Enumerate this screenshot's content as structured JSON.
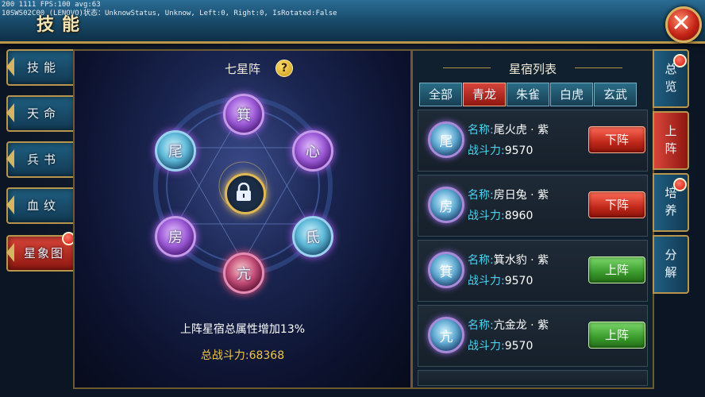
{
  "debug": {
    "line1": "200 1111 FPS:100 avg:63",
    "line2": "10SWS02C00 (LENOVO)状态：UnknowStatus, Unknow, Left:0, Right:0, IsRotated:False"
  },
  "header": {
    "title": "技能",
    "close_icon": "close-icon"
  },
  "left_tabs": [
    {
      "label": "技能"
    },
    {
      "label": "天命"
    },
    {
      "label": "兵书"
    },
    {
      "label": "血纹"
    },
    {
      "label": "星象图"
    }
  ],
  "center": {
    "title": "七星阵",
    "help_icon": "?",
    "bonus_text": "上阵星宿总属性增加13%",
    "total_power": "总战斗力:68368",
    "nodes": [
      {
        "glyph": "箕",
        "color": "purple"
      },
      {
        "glyph": "尾",
        "color": "blue"
      },
      {
        "glyph": "心",
        "color": "purple"
      },
      {
        "glyph": "房",
        "color": "purple"
      },
      {
        "glyph": "氐",
        "color": "blue"
      },
      {
        "glyph": "亢",
        "color": "red"
      }
    ]
  },
  "right": {
    "title": "星宿列表",
    "filters": [
      {
        "label": "全部"
      },
      {
        "label": "青龙"
      },
      {
        "label": "朱雀"
      },
      {
        "label": "白虎"
      },
      {
        "label": "玄武"
      }
    ],
    "active_filter": "青龙",
    "items": [
      {
        "glyph": "尾",
        "name_key": "名称:",
        "name": "尾火虎 · 紫",
        "power_key": "战斗力:",
        "power": "9570",
        "action": "下阵"
      },
      {
        "glyph": "房",
        "name_key": "名称:",
        "name": "房日兔 · 紫",
        "power_key": "战斗力:",
        "power": "8960",
        "action": "下阵"
      },
      {
        "glyph": "箕",
        "name_key": "名称:",
        "name": "箕水豹 · 紫",
        "power_key": "战斗力:",
        "power": "9570",
        "action": "上阵"
      },
      {
        "glyph": "亢",
        "name_key": "名称:",
        "name": "亢金龙 · 紫",
        "power_key": "战斗力:",
        "power": "9570",
        "action": "上阵"
      }
    ]
  },
  "right_tabs": [
    {
      "label": "总览"
    },
    {
      "label": "上阵"
    },
    {
      "label": "培养"
    },
    {
      "label": "分解"
    }
  ],
  "colors": {
    "accent_gold": "#b99648",
    "active_red": "#d9453a",
    "label_cyan": "#4cd2f0",
    "power_gold": "#f1c645"
  }
}
